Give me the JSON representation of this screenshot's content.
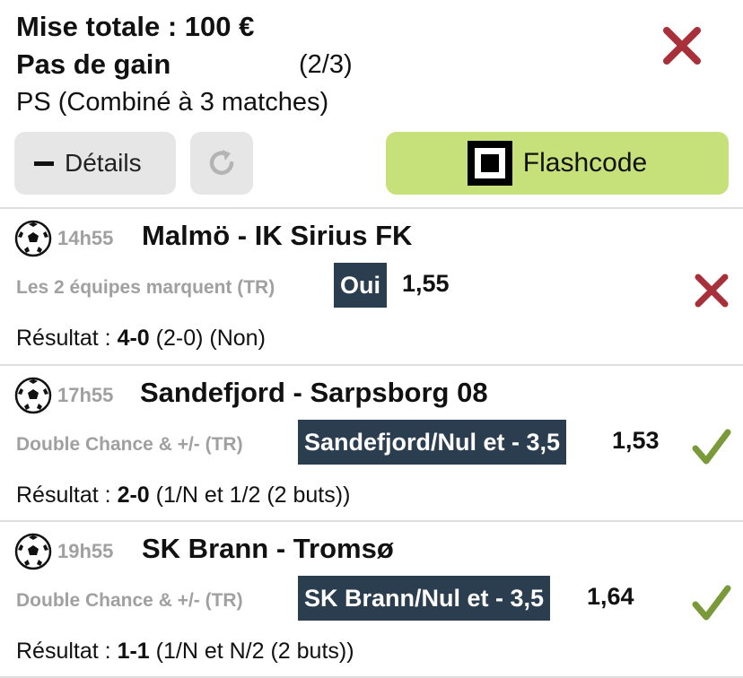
{
  "ticket": {
    "stake_text": "Mise totale : 100 €",
    "gain_text": "Pas de gain",
    "gain_count": "(2/3)",
    "bet_type": "PS (Combiné à 3 matches)",
    "status_icon": "red-x-icon"
  },
  "buttons": {
    "details_label": "Détails",
    "flashcode_label": "Flashcode"
  },
  "colors": {
    "lost": "#a8303b",
    "won": "#7a9a3a",
    "flashcode_bg": "#c6e07a",
    "pick_bg": "#2b3e50",
    "muted_text": "#a0a0a0"
  },
  "matches": [
    {
      "time": "14h55",
      "teams": "Malmö - IK Sirius FK",
      "market": "Les 2 équipes marquent (TR)",
      "pick": "Oui",
      "odds": "1,55",
      "result_label": "Résultat :",
      "result_score": "4-0",
      "result_detail": "(2-0) (Non)",
      "status": "lost"
    },
    {
      "time": "17h55",
      "teams": "Sandefjord - Sarpsborg 08",
      "market": "Double Chance & +/- (TR)",
      "pick": "Sandefjord/Nul et - 3,5",
      "odds": "1,53",
      "result_label": "Résultat :",
      "result_score": "2-0",
      "result_detail": "(1/N et 1/2 (2 buts))",
      "status": "won"
    },
    {
      "time": "19h55",
      "teams": "SK Brann - Tromsø",
      "market": "Double Chance & +/- (TR)",
      "pick": "SK Brann/Nul et - 3,5",
      "odds": "1,64",
      "result_label": "Résultat :",
      "result_score": "1-1",
      "result_detail": "(1/N et N/2 (2 buts))",
      "status": "won"
    }
  ]
}
